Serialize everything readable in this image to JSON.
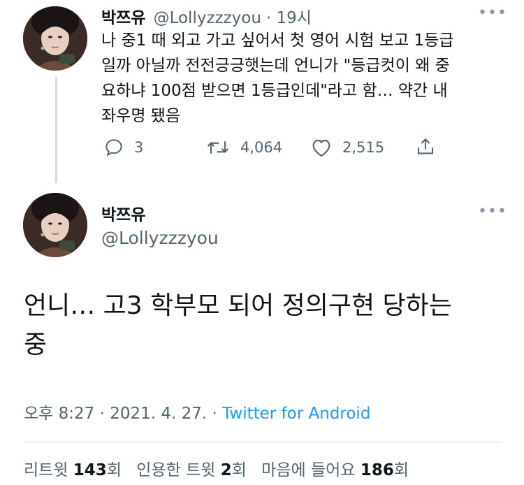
{
  "reply_tweet": {
    "display_name": "박쯔유",
    "handle": "@Lollyzzzyou",
    "separator": "·",
    "time_ago": "19시",
    "text_lines": [
      "나 중1 때 외고 가고 싶어서 첫 영어 시험 보고 1등급",
      "일까 아닐까 전전긍긍햇는데 언니가 \"등급컷이 왜 중",
      "요하냐 100점 받으면 1등급인데\"라고 함… 약간 내",
      "좌우명 됐음"
    ],
    "reply_count": "3",
    "retweet_count": "4,064",
    "like_count": "2,515",
    "more_label": "•••"
  },
  "main_tweet": {
    "display_name": "박쯔유",
    "handle": "@Lollyzzzyou",
    "more_label": "•••",
    "text_lines": [
      "언니… 고3 학부모 되어 정의구현 당하는",
      "중"
    ],
    "time": "오후 8:27",
    "sep1": "·",
    "date": "2021. 4. 27.",
    "sep2": "·",
    "source": "Twitter for Android",
    "source_color": "#1d9bf0"
  },
  "stats": {
    "retweets_label": "리트윗",
    "retweets_value": "143",
    "retweets_unit": "회",
    "quotes_label": "인용한 트윗",
    "quotes_value": "2",
    "quotes_unit": "회",
    "likes_label": "마음에 들어요",
    "likes_value": "186",
    "likes_unit": "회"
  },
  "icons": {
    "reply": "reply-icon",
    "retweet": "retweet-icon",
    "like": "heart-icon",
    "share": "share-icon"
  }
}
